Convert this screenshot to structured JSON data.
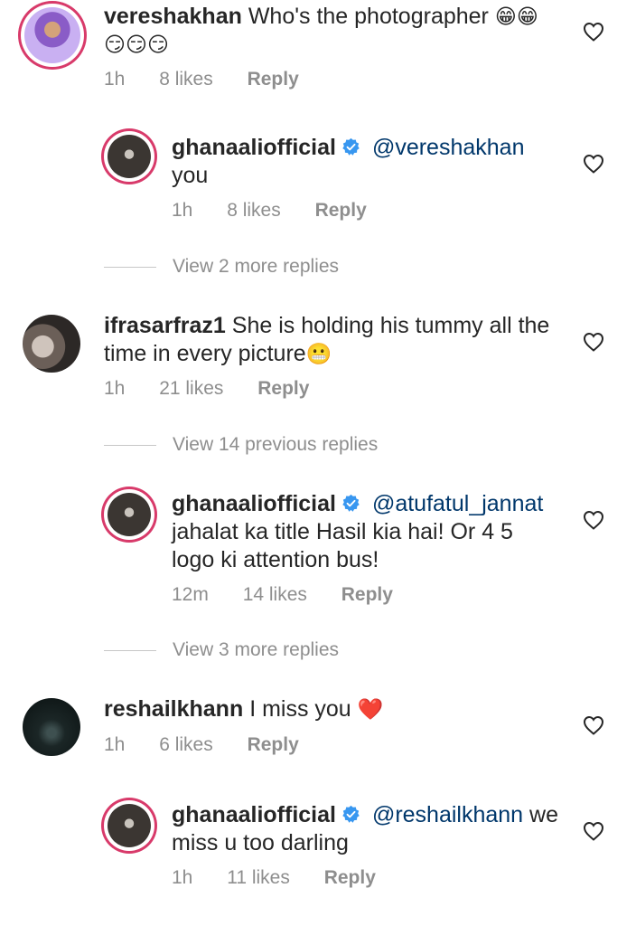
{
  "comments": [
    {
      "username": "vereshakhan",
      "text": "Who's the photographer",
      "emojis_line1": "😁😁",
      "emojis_line2": "😏😏😏",
      "time": "1h",
      "likes": "8 likes",
      "reply": "Reply"
    },
    {
      "username": "ghanaaliofficial",
      "mention": "@vereshakhan",
      "text": "you",
      "time": "1h",
      "likes": "8 likes",
      "reply": "Reply"
    },
    {
      "view_more": "View 2 more replies"
    },
    {
      "username": "ifrasarfraz1",
      "text_line1": "She is holding his tummy all the",
      "text_line2": "time in every picture",
      "emoji": "😬",
      "time": "1h",
      "likes": "21 likes",
      "reply": "Reply"
    },
    {
      "view_more": "View 14 previous replies"
    },
    {
      "username": "ghanaaliofficial",
      "mention": "@atufatul_jannat",
      "text_line1": "jahalat ka title Hasil kia hai! Or 4 5",
      "text_line2": "logo ki attention bus!",
      "time": "12m",
      "likes": "14 likes",
      "reply": "Reply"
    },
    {
      "view_more": "View 3 more replies"
    },
    {
      "username": "reshailkhann",
      "text": "I miss you",
      "emoji": "❤️",
      "time": "1h",
      "likes": "6 likes",
      "reply": "Reply"
    },
    {
      "username": "ghanaaliofficial",
      "mention": "@reshailkhann",
      "text_line1": "we",
      "text_line2": "miss u too darling",
      "time": "1h",
      "likes": "11 likes",
      "reply": "Reply"
    }
  ],
  "icons": {
    "like": "heart-outline-icon",
    "verified": "verified-badge-icon"
  },
  "colors": {
    "text": "#262626",
    "meta": "#8e8e8e",
    "mention": "#00376b",
    "verified": "#3897f0",
    "story_ring": "#d83a6a"
  }
}
